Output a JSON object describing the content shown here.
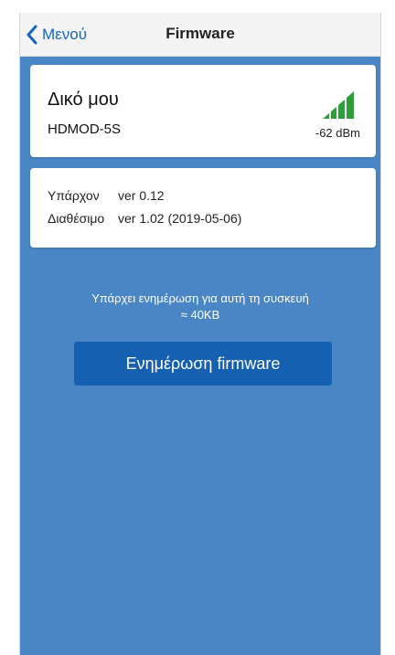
{
  "navbar": {
    "back_label": "Μενού",
    "title": "Firmware"
  },
  "device": {
    "name": "Δικό μου",
    "model": "HDMOD-5S",
    "signal_strength": "-62 dBm",
    "signal_bars_filled": 4,
    "signal_bars_total": 4,
    "signal_color": "#2e9e3a"
  },
  "versions": {
    "current_label": "Υπάρχον",
    "current_value": "ver 0.12",
    "available_label": "Διαθέσιμο",
    "available_value": "ver 1.02 (2019-05-06)"
  },
  "update": {
    "message": "Υπάρχει ενημέρωση για αυτή τη συσκευή",
    "size": "≈ 40KB",
    "button_label": "Ενημέρωση firmware"
  },
  "colors": {
    "accent": "#1565c0",
    "background": "#4a86c5",
    "button": "#1560b1"
  },
  "icons": {
    "back": "chevron-left-icon",
    "signal": "signal-strength-icon"
  }
}
